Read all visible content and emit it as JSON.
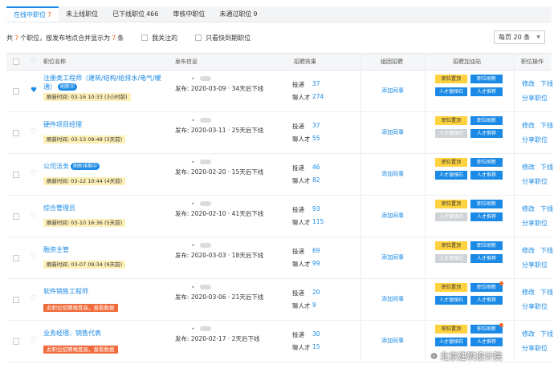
{
  "tabs": [
    {
      "label": "在线中职位",
      "count": "7",
      "active": true
    },
    {
      "label": "未上线职位",
      "count": ""
    },
    {
      "label": "已下线职位",
      "count": "466"
    },
    {
      "label": "审核中职位",
      "count": ""
    },
    {
      "label": "未通过职位",
      "count": "9"
    }
  ],
  "filter": {
    "prefix": "共",
    "total": "7",
    "middle": "个职位，按发布地点合并显示为",
    "merged": "7",
    "suffix": "条",
    "my_follow": "我关注的",
    "expiring": "只看快到期职位",
    "per_page": "每页 20 条"
  },
  "headers": {
    "name": "职位名称",
    "publish": "发布信息",
    "effect": "招聘效果",
    "team": "组团招聘",
    "promote": "招聘加油站",
    "ops": "职位操作"
  },
  "labels": {
    "pub_prefix": "发布:",
    "apply": "投递",
    "chat": "聊人才",
    "invite": "添加同事",
    "btn_top": "职位置顶",
    "btn_refresh": "职位刷新",
    "btn_bank": "人才银弹石",
    "btn_recommend": "人才推荐",
    "op_edit": "修改",
    "op_offline": "下线",
    "op_share": "分享职位"
  },
  "rows": [
    {
      "title": "注册类工程师（建筑/结构/给排水/电气/暖通）",
      "badge": "刷新中",
      "refresh": "刷新时间: 03-16 10:33 (3小时前)",
      "date": "2020-03-09",
      "remain": "34天后下线",
      "apply": "37",
      "chat": "274",
      "favorite": true
    },
    {
      "title": "硬件项目经理",
      "badge": "",
      "refresh": "刷新时间: 03-13 09:48 (3天前)",
      "date": "2020-03-11",
      "remain": "25天后下线",
      "apply": "37",
      "chat": "55",
      "favorite": false
    },
    {
      "title": "公司法务",
      "badge": "刷新排期中",
      "refresh": "刷新时间: 03-12 10:44 (4天前)",
      "date": "2020-02-20",
      "remain": "15天后下线",
      "apply": "46",
      "chat": "82",
      "favorite": false
    },
    {
      "title": "综合管理员",
      "badge": "",
      "refresh": "刷新时间: 03-10 16:36 (5天前)",
      "date": "2020-02-10",
      "remain": "41天后下线",
      "apply": "93",
      "chat": "115",
      "favorite": false
    },
    {
      "title": "融资主管",
      "badge": "",
      "refresh": "刷新时间: 03-07 09:34 (9天前)",
      "date": "2020-03-03",
      "remain": "18天后下线",
      "apply": "69",
      "chat": "99",
      "favorite": false
    },
    {
      "title": "软件销售工程师",
      "badge": "",
      "warn": "此职位招聘难度高，查看数据",
      "date": "2020-03-06",
      "remain": "21天后下线",
      "apply": "20",
      "chat": "9",
      "favorite": false
    },
    {
      "title": "业务经理、销售代表",
      "badge": "",
      "warn": "此职位招聘难度高，查看数据",
      "date": "2020-02-17",
      "remain": "2天后下线",
      "apply": "30",
      "chat": "15",
      "favorite": false
    }
  ],
  "watermark": "北京建筑设计院",
  "colors": {
    "accent": "#1a8ae6",
    "highlight": "#f46a26",
    "top_button": "#ffd23f",
    "warn": "#f06b3b",
    "refresh_bg": "#fdefb6"
  }
}
